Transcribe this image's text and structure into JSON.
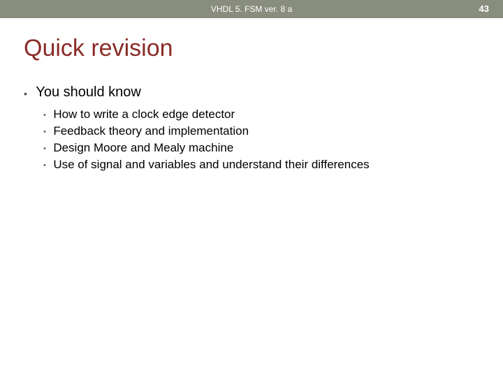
{
  "header": {
    "center": "VHDL 5. FSM ver. 8 a",
    "page": "43"
  },
  "title": "Quick revision",
  "bullet_glyph": "•",
  "level1": {
    "text": "You should know"
  },
  "level2": [
    {
      "text": "How to write a clock edge detector"
    },
    {
      "text": "Feedback theory and implementation"
    },
    {
      "text": "Design Moore and Mealy machine"
    },
    {
      "text": "Use of signal and variables and understand their differences"
    }
  ]
}
